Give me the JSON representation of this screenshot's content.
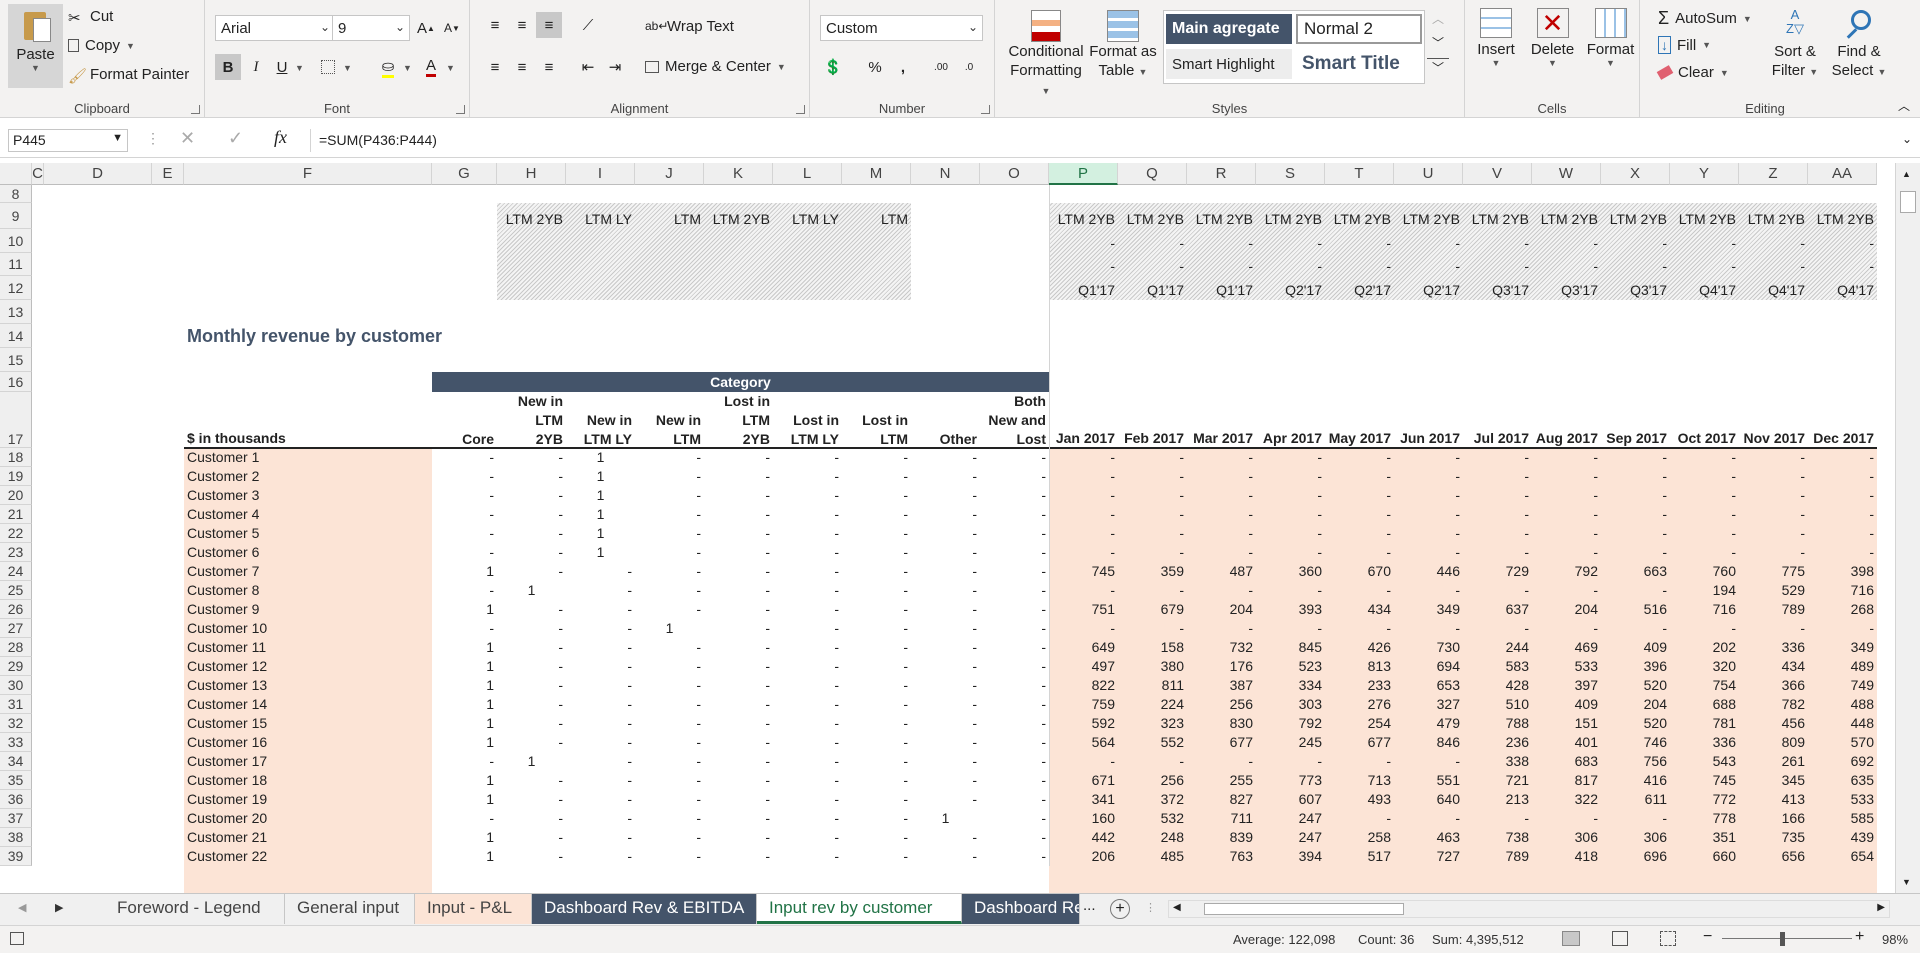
{
  "ribbon": {
    "clipboard": {
      "label": "Clipboard",
      "paste": "Paste",
      "cut": "Cut",
      "copy": "Copy",
      "format_painter": "Format Painter"
    },
    "font": {
      "label": "Font",
      "family": "Arial",
      "size": "9",
      "bold": "B",
      "italic": "I",
      "underline": "U",
      "grow": "A",
      "shrink": "A",
      "color_letter": "A"
    },
    "alignment": {
      "label": "Alignment",
      "wrap_text": "Wrap Text",
      "merge_center": "Merge & Center"
    },
    "number": {
      "label": "Number",
      "format": "Custom",
      "percent": "%",
      "comma": ",",
      "inc_decimal": ".00",
      "dec_decimal": ".0"
    },
    "styles": {
      "label": "Styles",
      "conditional_formatting": [
        "Conditional",
        "Formatting"
      ],
      "format_as_table": [
        "Format as",
        "Table"
      ],
      "gallery": [
        "Main agregate",
        "Normal 2",
        "Smart Highlight",
        "Smart Title"
      ]
    },
    "cells": {
      "label": "Cells",
      "insert": "Insert",
      "delete": "Delete",
      "format": "Format"
    },
    "editing": {
      "label": "Editing",
      "autosum": "AutoSum",
      "fill": "Fill",
      "clear": "Clear",
      "sort_filter": [
        "Sort &",
        "Filter"
      ],
      "find_select": [
        "Find &",
        "Select"
      ]
    }
  },
  "formula_bar": {
    "name_box": "P445",
    "formula": "=SUM(P436:P444)"
  },
  "grid": {
    "columns": [
      "C",
      "D",
      "E",
      "F",
      "G",
      "H",
      "I",
      "J",
      "K",
      "L",
      "M",
      "N",
      "O",
      "P",
      "Q",
      "R",
      "S",
      "T",
      "U",
      "V",
      "W",
      "X",
      "Y",
      "Z",
      "AA"
    ],
    "header_row_9": [
      "LTM 2YB",
      "LTM LY",
      "LTM",
      "LTM 2YB",
      "LTM LY",
      "LTM"
    ],
    "header_row_9_months": [
      "LTM 2YB",
      "LTM 2YB",
      "LTM 2YB",
      "LTM 2YB",
      "LTM 2YB",
      "LTM 2YB",
      "LTM 2YB",
      "LTM 2YB",
      "LTM 2YB",
      "LTM 2YB",
      "LTM 2YB",
      "LTM 2YB"
    ],
    "row_10": [
      "-",
      "-",
      "-",
      "-",
      "-",
      "-",
      "-",
      "-",
      "-",
      "-",
      "-",
      "-"
    ],
    "row_11": [
      "-",
      "-",
      "-",
      "-",
      "-",
      "-",
      "-",
      "-",
      "-",
      "-",
      "-",
      "-"
    ],
    "quarters": [
      "Q1'17",
      "Q1'17",
      "Q1'17",
      "Q2'17",
      "Q2'17",
      "Q2'17",
      "Q3'17",
      "Q3'17",
      "Q3'17",
      "Q4'17",
      "Q4'17",
      "Q4'17"
    ],
    "title": "Monthly revenue by customer",
    "category_label": "Category",
    "units_label": "$ in thousands",
    "category_headers": [
      [
        "",
        "",
        "Core"
      ],
      [
        "New in",
        "LTM",
        "2YB"
      ],
      [
        "",
        "New in",
        "LTM LY"
      ],
      [
        "",
        "New in",
        "LTM"
      ],
      [
        "Lost in",
        "LTM",
        "2YB"
      ],
      [
        "",
        "Lost in",
        "LTM LY"
      ],
      [
        "",
        "Lost in",
        "LTM"
      ],
      [
        "",
        "",
        "Other"
      ],
      [
        "Both",
        "New and",
        "Lost"
      ]
    ],
    "months": [
      "Jan 2017",
      "Feb 2017",
      "Mar 2017",
      "Apr 2017",
      "May 2017",
      "Jun 2017",
      "Jul 2017",
      "Aug 2017",
      "Sep 2017",
      "Oct 2017",
      "Nov 2017",
      "Dec 2017"
    ],
    "rows": [
      {
        "r": "18",
        "name": "Customer 1",
        "cat": [
          "-",
          "-",
          "1",
          "-",
          "-",
          "-",
          "-",
          "-",
          "-"
        ],
        "m": [
          "-",
          "-",
          "-",
          "-",
          "-",
          "-",
          "-",
          "-",
          "-",
          "-",
          "-",
          "-"
        ]
      },
      {
        "r": "19",
        "name": "Customer 2",
        "cat": [
          "-",
          "-",
          "1",
          "-",
          "-",
          "-",
          "-",
          "-",
          "-"
        ],
        "m": [
          "-",
          "-",
          "-",
          "-",
          "-",
          "-",
          "-",
          "-",
          "-",
          "-",
          "-",
          "-"
        ]
      },
      {
        "r": "20",
        "name": "Customer 3",
        "cat": [
          "-",
          "-",
          "1",
          "-",
          "-",
          "-",
          "-",
          "-",
          "-"
        ],
        "m": [
          "-",
          "-",
          "-",
          "-",
          "-",
          "-",
          "-",
          "-",
          "-",
          "-",
          "-",
          "-"
        ]
      },
      {
        "r": "21",
        "name": "Customer 4",
        "cat": [
          "-",
          "-",
          "1",
          "-",
          "-",
          "-",
          "-",
          "-",
          "-"
        ],
        "m": [
          "-",
          "-",
          "-",
          "-",
          "-",
          "-",
          "-",
          "-",
          "-",
          "-",
          "-",
          "-"
        ]
      },
      {
        "r": "22",
        "name": "Customer 5",
        "cat": [
          "-",
          "-",
          "1",
          "-",
          "-",
          "-",
          "-",
          "-",
          "-"
        ],
        "m": [
          "-",
          "-",
          "-",
          "-",
          "-",
          "-",
          "-",
          "-",
          "-",
          "-",
          "-",
          "-"
        ]
      },
      {
        "r": "23",
        "name": "Customer 6",
        "cat": [
          "-",
          "-",
          "1",
          "-",
          "-",
          "-",
          "-",
          "-",
          "-"
        ],
        "m": [
          "-",
          "-",
          "-",
          "-",
          "-",
          "-",
          "-",
          "-",
          "-",
          "-",
          "-",
          "-"
        ]
      },
      {
        "r": "24",
        "name": "Customer 7",
        "cat": [
          "1",
          "-",
          "-",
          "-",
          "-",
          "-",
          "-",
          "-",
          "-"
        ],
        "m": [
          "745",
          "359",
          "487",
          "360",
          "670",
          "446",
          "729",
          "792",
          "663",
          "760",
          "775",
          "398"
        ]
      },
      {
        "r": "25",
        "name": "Customer 8",
        "cat": [
          "-",
          "1",
          "-",
          "-",
          "-",
          "-",
          "-",
          "-",
          "-"
        ],
        "m": [
          "-",
          "-",
          "-",
          "-",
          "-",
          "-",
          "-",
          "-",
          "-",
          "194",
          "529",
          "716"
        ]
      },
      {
        "r": "26",
        "name": "Customer 9",
        "cat": [
          "1",
          "-",
          "-",
          "-",
          "-",
          "-",
          "-",
          "-",
          "-"
        ],
        "m": [
          "751",
          "679",
          "204",
          "393",
          "434",
          "349",
          "637",
          "204",
          "516",
          "716",
          "789",
          "268"
        ]
      },
      {
        "r": "27",
        "name": "Customer 10",
        "cat": [
          "-",
          "-",
          "-",
          "1",
          "-",
          "-",
          "-",
          "-",
          "-"
        ],
        "m": [
          "-",
          "-",
          "-",
          "-",
          "-",
          "-",
          "-",
          "-",
          "-",
          "-",
          "-",
          "-"
        ]
      },
      {
        "r": "28",
        "name": "Customer 11",
        "cat": [
          "1",
          "-",
          "-",
          "-",
          "-",
          "-",
          "-",
          "-",
          "-"
        ],
        "m": [
          "649",
          "158",
          "732",
          "845",
          "426",
          "730",
          "244",
          "469",
          "409",
          "202",
          "336",
          "349"
        ]
      },
      {
        "r": "29",
        "name": "Customer 12",
        "cat": [
          "1",
          "-",
          "-",
          "-",
          "-",
          "-",
          "-",
          "-",
          "-"
        ],
        "m": [
          "497",
          "380",
          "176",
          "523",
          "813",
          "694",
          "583",
          "533",
          "396",
          "320",
          "434",
          "489"
        ]
      },
      {
        "r": "30",
        "name": "Customer 13",
        "cat": [
          "1",
          "-",
          "-",
          "-",
          "-",
          "-",
          "-",
          "-",
          "-"
        ],
        "m": [
          "822",
          "811",
          "387",
          "334",
          "233",
          "653",
          "428",
          "397",
          "520",
          "754",
          "366",
          "749"
        ]
      },
      {
        "r": "31",
        "name": "Customer 14",
        "cat": [
          "1",
          "-",
          "-",
          "-",
          "-",
          "-",
          "-",
          "-",
          "-"
        ],
        "m": [
          "759",
          "224",
          "256",
          "303",
          "276",
          "327",
          "510",
          "409",
          "204",
          "688",
          "782",
          "488"
        ]
      },
      {
        "r": "32",
        "name": "Customer 15",
        "cat": [
          "1",
          "-",
          "-",
          "-",
          "-",
          "-",
          "-",
          "-",
          "-"
        ],
        "m": [
          "592",
          "323",
          "830",
          "792",
          "254",
          "479",
          "788",
          "151",
          "520",
          "781",
          "456",
          "448"
        ]
      },
      {
        "r": "33",
        "name": "Customer 16",
        "cat": [
          "1",
          "-",
          "-",
          "-",
          "-",
          "-",
          "-",
          "-",
          "-"
        ],
        "m": [
          "564",
          "552",
          "677",
          "245",
          "677",
          "846",
          "236",
          "401",
          "746",
          "336",
          "809",
          "570"
        ]
      },
      {
        "r": "34",
        "name": "Customer 17",
        "cat": [
          "-",
          "1",
          "-",
          "-",
          "-",
          "-",
          "-",
          "-",
          "-"
        ],
        "m": [
          "-",
          "-",
          "-",
          "-",
          "-",
          "-",
          "338",
          "683",
          "756",
          "543",
          "261",
          "692"
        ]
      },
      {
        "r": "35",
        "name": "Customer 18",
        "cat": [
          "1",
          "-",
          "-",
          "-",
          "-",
          "-",
          "-",
          "-",
          "-"
        ],
        "m": [
          "671",
          "256",
          "255",
          "773",
          "713",
          "551",
          "721",
          "817",
          "416",
          "745",
          "345",
          "635"
        ]
      },
      {
        "r": "36",
        "name": "Customer 19",
        "cat": [
          "1",
          "-",
          "-",
          "-",
          "-",
          "-",
          "-",
          "-",
          "-"
        ],
        "m": [
          "341",
          "372",
          "827",
          "607",
          "493",
          "640",
          "213",
          "322",
          "611",
          "772",
          "413",
          "533"
        ]
      },
      {
        "r": "37",
        "name": "Customer 20",
        "cat": [
          "-",
          "-",
          "-",
          "-",
          "-",
          "-",
          "-",
          "1",
          "-"
        ],
        "m": [
          "160",
          "532",
          "711",
          "247",
          "-",
          "-",
          "-",
          "-",
          "-",
          "778",
          "166",
          "585"
        ]
      },
      {
        "r": "38",
        "name": "Customer 21",
        "cat": [
          "1",
          "-",
          "-",
          "-",
          "-",
          "-",
          "-",
          "-",
          "-"
        ],
        "m": [
          "442",
          "248",
          "839",
          "247",
          "258",
          "463",
          "738",
          "306",
          "306",
          "351",
          "735",
          "439"
        ]
      },
      {
        "r": "39",
        "name": "Customer 22",
        "cat": [
          "1",
          "-",
          "-",
          "-",
          "-",
          "-",
          "-",
          "-",
          "-"
        ],
        "m": [
          "206",
          "485",
          "763",
          "394",
          "517",
          "727",
          "789",
          "418",
          "696",
          "660",
          "656",
          "654"
        ]
      }
    ],
    "row_numbers_top": [
      "8",
      "9",
      "10",
      "11",
      "12",
      "13",
      "14",
      "15",
      "16",
      "17"
    ]
  },
  "sheet_tabs": [
    "Foreword - Legend",
    "General input",
    "Input - P&L",
    "Dashboard Rev & EBITDA",
    "Input rev by customer",
    "Dashboard Re"
  ],
  "sheet_tabs_more": "...",
  "status": {
    "average": "Average:  122,098",
    "count": "Count: 36",
    "sum": "Sum:  4,395,512",
    "zoom": "98%"
  }
}
